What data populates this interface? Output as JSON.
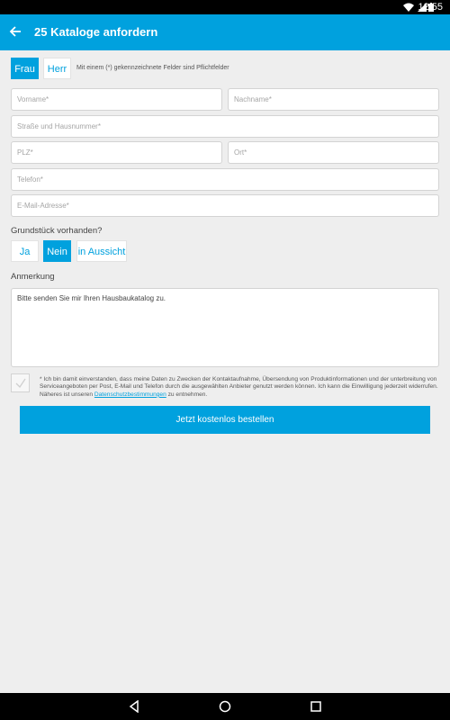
{
  "status_bar": {
    "time": "12:55"
  },
  "app_bar": {
    "title": "25 Kataloge anfordern"
  },
  "salutation": {
    "frau": "Frau",
    "herr": "Herr",
    "selected": "Frau"
  },
  "required_hint": "Mit einem (*) gekennzeichnete Felder sind Pflichtfelder",
  "fields": {
    "vorname": "Vorname*",
    "nachname": "Nachname*",
    "strasse": "Straße und Hausnummer*",
    "plz": "PLZ*",
    "ort": "Ort*",
    "telefon": "Telefon*",
    "email": "E-Mail-Adresse*"
  },
  "grundstueck": {
    "question": "Grundstück vorhanden?",
    "options": [
      "Ja",
      "Nein",
      "in Aussicht"
    ],
    "selected": "Nein"
  },
  "anmerkung": {
    "label": "Anmerkung",
    "value": "Bitte senden Sie mir Ihren Hausbaukatalog zu."
  },
  "consent": {
    "text": "* Ich bin damit einverstanden, dass meine Daten zu Zwecken der Kontaktaufnahme, Übersendung von Produktinformationen und der unterbreitung von Serviceangeboten per Post, E-Mail und Telefon durch die ausgewählten Anbieter genutzt werden können. Ich kann die Einwilligung jederzeit widerrufen. Näheres ist unseren",
    "link": "Datenschutzbestimmungen",
    "suffix": "zu entnehmen.",
    "checked": true
  },
  "submit_label": "Jetzt kostenlos bestellen",
  "colors": {
    "primary": "#00a1de",
    "background": "#eeeeee"
  }
}
